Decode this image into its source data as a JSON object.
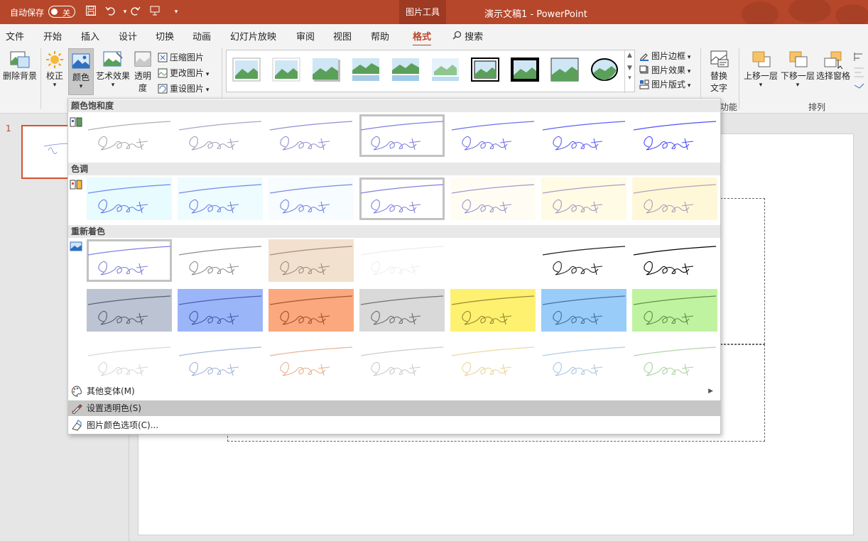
{
  "titlebar": {
    "autosave": "自动保存",
    "toggle": "关",
    "context_tab": "图片工具",
    "doc_title": "演示文稿1  -  PowerPoint"
  },
  "tabs": [
    "文件",
    "开始",
    "插入",
    "设计",
    "切换",
    "动画",
    "幻灯片放映",
    "审阅",
    "视图",
    "帮助",
    "格式"
  ],
  "search_label": "搜索",
  "ribbon": {
    "remove_bg": "删除背景",
    "correct": "校正",
    "color": "颜色",
    "artistic": "艺术效果",
    "transparency_1": "透明",
    "transparency_2": "度",
    "compress": "压缩图片",
    "change": "更改图片",
    "reset": "重设图片",
    "border": "图片边框",
    "effects": "图片效果",
    "layout": "图片版式",
    "alt_text_1": "替换",
    "alt_text_2": "文字",
    "group_func": "功能",
    "bring_forward": "上移一层",
    "send_backward": "下移一层",
    "selection_pane": "选择窗格",
    "group_arrange": "排列"
  },
  "slide_panel": {
    "number": "1"
  },
  "dropdown": {
    "sections": {
      "saturation": "颜色饱和度",
      "tone": "色调",
      "recolor": "重新着色"
    },
    "menu": [
      {
        "label": "其他变体(M)"
      },
      {
        "label": "设置透明色(S)"
      },
      {
        "label": "图片颜色选项(C)..."
      }
    ]
  },
  "colors": {
    "accent": "#b7472a",
    "saturation": [
      {
        "bg": "#ffffff",
        "ink": "#a9a9a9",
        "line": "#b0b0b0"
      },
      {
        "bg": "#ffffff",
        "ink": "#9f9fb8",
        "line": "#a8a8c0"
      },
      {
        "bg": "#ffffff",
        "ink": "#8f8fd0",
        "line": "#9090d4"
      },
      {
        "bg": "#ffffff",
        "ink": "#7f7fde",
        "line": "#8080e2"
      },
      {
        "bg": "#ffffff",
        "ink": "#6f6fe8",
        "line": "#7070ec"
      },
      {
        "bg": "#ffffff",
        "ink": "#5e5ef0",
        "line": "#6060f4"
      },
      {
        "bg": "#ffffff",
        "ink": "#4a4af8",
        "line": "#5050fb"
      }
    ],
    "tone": [
      {
        "bg": "#e8fbff",
        "ink": "#5f78e8",
        "line": "#6f88ee"
      },
      {
        "bg": "#eefbff",
        "ink": "#6a7ee2",
        "line": "#7488e8"
      },
      {
        "bg": "#f6fcff",
        "ink": "#7680dd",
        "line": "#7e88e0"
      },
      {
        "bg": "#ffffff",
        "ink": "#7f7fde",
        "line": "#8080e2"
      },
      {
        "bg": "#fffdf3",
        "ink": "#9a8fd0",
        "line": "#a098cc"
      },
      {
        "bg": "#fffbe4",
        "ink": "#a594c4",
        "line": "#aa9cc0"
      },
      {
        "bg": "#fff8d8",
        "ink": "#ac98bc",
        "line": "#b2a0b8"
      }
    ],
    "recolor_row1": [
      {
        "bg": "#ffffff",
        "ink": "#7f7fde",
        "line": "#8080e2"
      },
      {
        "bg": "#ffffff",
        "ink": "#8a8a8a",
        "line": "#8c8c8c"
      },
      {
        "bg": "#f2e1cf",
        "ink": "#9a8a7c",
        "line": "#a0907f"
      },
      {
        "bg": "#ffffff",
        "ink": "#efefef",
        "line": "#ededed"
      },
      {
        "bg": "#ffffff",
        "ink": "#ffffff",
        "line": "#ffffff"
      },
      {
        "bg": "#ffffff",
        "ink": "#1e1e1e",
        "line": "#1e1e1e"
      },
      {
        "bg": "#ffffff",
        "ink": "#000000",
        "line": "#000000"
      }
    ],
    "recolor_row2": [
      {
        "bg": "#bcc3d3",
        "ink": "#555b6e",
        "line": "#5a6072"
      },
      {
        "bg": "#9bb5f9",
        "ink": "#3f57a6",
        "line": "#4a5fb0"
      },
      {
        "bg": "#fba87e",
        "ink": "#a04e28",
        "line": "#a85630"
      },
      {
        "bg": "#d9d9d9",
        "ink": "#6a6a6a",
        "line": "#707070"
      },
      {
        "bg": "#fef16f",
        "ink": "#8f8530",
        "line": "#948a36"
      },
      {
        "bg": "#99ccf9",
        "ink": "#3f6c9a",
        "line": "#4572a0"
      },
      {
        "bg": "#bff3a0",
        "ink": "#5b8a44",
        "line": "#62904a"
      }
    ],
    "recolor_row3": [
      {
        "bg": "#ffffff",
        "ink": "#d6d6d6",
        "line": "#d8d8d8"
      },
      {
        "bg": "#ffffff",
        "ink": "#9fb3d8",
        "line": "#a6b8dc"
      },
      {
        "bg": "#ffffff",
        "ink": "#e6ae92",
        "line": "#e8b49a"
      },
      {
        "bg": "#ffffff",
        "ink": "#c9c9c9",
        "line": "#cccccc"
      },
      {
        "bg": "#ffffff",
        "ink": "#e8d49a",
        "line": "#eadaa4"
      },
      {
        "bg": "#ffffff",
        "ink": "#a9c6e0",
        "line": "#b0cce4"
      },
      {
        "bg": "#ffffff",
        "ink": "#aad0a0",
        "line": "#b2d6a8"
      }
    ]
  }
}
